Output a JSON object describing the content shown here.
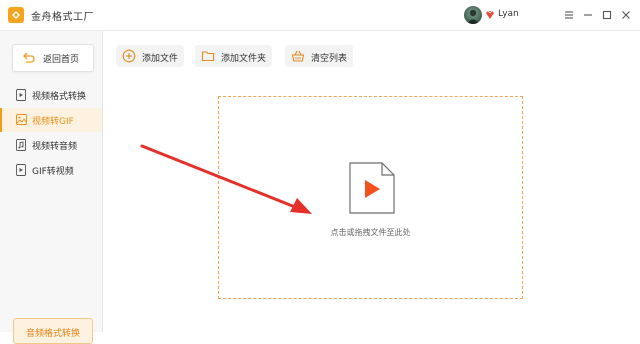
{
  "app": {
    "title": "金舟格式工厂"
  },
  "user": {
    "name": "Lyan"
  },
  "window_controls": [
    "menu-icon",
    "minimize-icon",
    "maximize-icon",
    "close-icon"
  ],
  "sidebar": {
    "home_label": "返回首页",
    "items": [
      {
        "label": "视频格式转换",
        "icon": "video-file-icon",
        "active": false
      },
      {
        "label": "视频转GIF",
        "icon": "gif-image-icon",
        "active": true
      },
      {
        "label": "视频转音频",
        "icon": "audio-file-icon",
        "active": false
      },
      {
        "label": "GIF转视频",
        "icon": "video-file-icon",
        "active": false
      }
    ],
    "bottom_label": "音频格式转换"
  },
  "toolbar": {
    "add_file": "添加文件",
    "add_folder": "添加文件夹",
    "clear_list": "清空列表"
  },
  "dropzone": {
    "hint": "点击或拖拽文件至此处"
  },
  "colors": {
    "accent": "#f29c1f",
    "play": "#f4511e",
    "arrow": "#e5302a",
    "dash": "#f0a45a"
  }
}
